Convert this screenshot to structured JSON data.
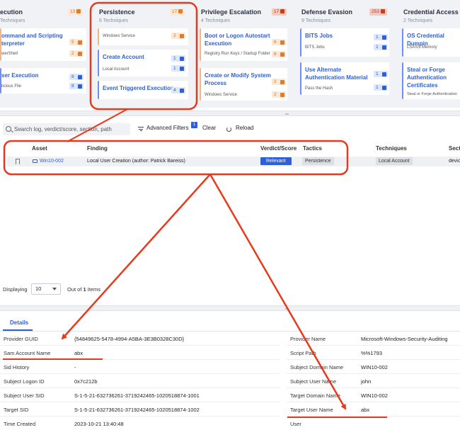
{
  "tactics": [
    {
      "title": "ecution",
      "subtitle": "Techniques",
      "count": "13",
      "techniques": [
        {
          "name_lines": [
            "ommand and Scripting",
            "terpreter"
          ],
          "sub": "werShell",
          "pills": [
            "5",
            "2"
          ],
          "pill_color": "orange"
        },
        {
          "name_lines": [
            "ser Execution"
          ],
          "sub": "licious File",
          "pills": [
            "8",
            "8"
          ],
          "pill_color": "blue"
        }
      ]
    },
    {
      "title": "Persistence",
      "subtitle": "6 Techniques",
      "count": "17",
      "techniques": [
        {
          "name_lines": [],
          "sub": "Windows Service",
          "pills": [
            "2"
          ],
          "pill_color": "orange"
        },
        {
          "name_lines": [
            "Create Account"
          ],
          "sub": "Local Account",
          "pills": [
            "1",
            "1"
          ],
          "pill_color": "blue"
        },
        {
          "name_lines": [
            "Event Triggered Execution"
          ],
          "sub": "",
          "pills": [
            "4"
          ],
          "pill_color": "blue"
        }
      ]
    },
    {
      "title": "Privilege Escalation",
      "subtitle": "4 Techniques",
      "count": "17",
      "techniques": [
        {
          "name_lines": [
            "Boot or Logon Autostart",
            "Execution"
          ],
          "sub": "Registry Run Keys / Startup Folder",
          "pills": [
            "6",
            "6"
          ],
          "pill_color": "orange"
        },
        {
          "name_lines": [
            "Create or Modify System",
            "Process"
          ],
          "sub": "Windows Service",
          "pills": [
            "2",
            "2"
          ],
          "pill_color": "orange"
        }
      ]
    },
    {
      "title": "Defense Evasion",
      "subtitle": "9 Techniques",
      "count": "253",
      "techniques": [
        {
          "name_lines": [
            "BITS Jobs"
          ],
          "sub": "BITS Jobs",
          "pills": [
            "1",
            "1"
          ],
          "pill_color": "blue"
        },
        {
          "name_lines": [
            "Use Alternate",
            "Authentication Material"
          ],
          "sub": "Pass the Hash",
          "pills": [
            "1",
            "1"
          ],
          "pill_color": "blue"
        }
      ]
    },
    {
      "title": "Credential Access",
      "subtitle": "2 Techniques",
      "count": "",
      "techniques": [
        {
          "name_lines": [
            "OS Credential Dumpin"
          ],
          "sub": "LSASS Memory",
          "pills": [],
          "pill_color": "blue"
        },
        {
          "name_lines": [
            "Steal or Forge",
            "Authentication",
            "Certificates"
          ],
          "sub": "Steal or Forge Authentication",
          "pills": [],
          "pill_color": "blue"
        }
      ]
    }
  ],
  "toolbar": {
    "search_placeholder": "Search log, verdict/score, section, path",
    "advanced_filters": "Advanced Filters",
    "filter_badge": "1",
    "clear": "Clear",
    "reload": "Reload"
  },
  "table": {
    "columns": [
      "Asset",
      "Finding",
      "Verdict/Score",
      "Tactics",
      "Techniques",
      "Secti"
    ],
    "rows": [
      {
        "asset": "Win10-002",
        "finding": "Local User Creation (author: Patrick Bareiss)",
        "verdict": "Relevant",
        "tactics": "Persistence",
        "techniques": "Local Account",
        "section": "devic"
      }
    ]
  },
  "pager": {
    "displaying": "Displaying",
    "page_size": "10",
    "out_of": "Out of",
    "total": "1",
    "items": "Items"
  },
  "details": {
    "tab": "Details",
    "left": [
      {
        "key": "Provider GUID",
        "value": "{54849625-5478-4994-A5BA-3E3B0328C30D}"
      },
      {
        "key": "Sam Account Name",
        "value": "abx"
      },
      {
        "key": "Sid History",
        "value": "-"
      },
      {
        "key": "Subject Logon ID",
        "value": "0x7c212b"
      },
      {
        "key": "Subject User SID",
        "value": "S-1-5-21-632736261-3719242465-1020518874-1001"
      },
      {
        "key": "Target SID",
        "value": "S-1-5-21-632736261-3719242465-1020518874-1002"
      },
      {
        "key": "Time Created",
        "value": "2023-10-21 13:40:48"
      }
    ],
    "right": [
      {
        "key": "Provider Name",
        "value": "Microsoft-Windows-Security-Auditing"
      },
      {
        "key": "Script Path",
        "value": "%%1793"
      },
      {
        "key": "Subject Domain Name",
        "value": "WIN10-002"
      },
      {
        "key": "Subject User Name",
        "value": "john"
      },
      {
        "key": "Target Domain Name",
        "value": "WIN10-002"
      },
      {
        "key": "Target User Name",
        "value": "abx"
      },
      {
        "key": "User",
        "value": ""
      }
    ]
  },
  "colors": {
    "annotation": "#e8391c",
    "accent": "#2f5fd6",
    "orange": "#e27c2c"
  }
}
